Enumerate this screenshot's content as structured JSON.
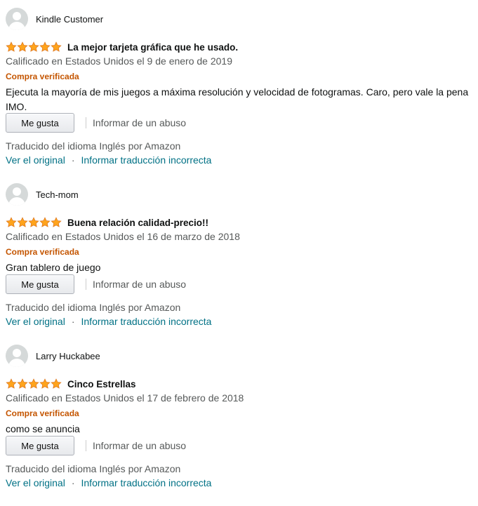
{
  "colors": {
    "star": "#ffa41c",
    "link": "#007185",
    "verified": "#c45500",
    "muted": "#565959"
  },
  "reviews": [
    {
      "profile_name": "Kindle Customer",
      "rating": 5,
      "title": "La mejor tarjeta gráfica que he usado.",
      "date": "Calificado en Estados Unidos el 9 de enero de 2019",
      "verified": "Compra verificada",
      "body": "Ejecuta la mayoría de mis juegos a máxima resolución y velocidad de fotogramas. Caro, pero vale la pena IMO.",
      "helpful_label": "Me gusta",
      "report_label": "Informar de un abuso",
      "translated": "Traducido del idioma Inglés por Amazon",
      "see_original": "Ver el original",
      "separator": "·",
      "report_translation": "Informar traducción incorrecta"
    },
    {
      "profile_name": "Tech-mom",
      "rating": 5,
      "title": "Buena relación calidad-precio!!",
      "date": "Calificado en Estados Unidos el 16 de marzo de 2018",
      "verified": "Compra verificada",
      "body": "Gran tablero de juego",
      "helpful_label": "Me gusta",
      "report_label": "Informar de un abuso",
      "translated": "Traducido del idioma Inglés por Amazon",
      "see_original": "Ver el original",
      "separator": "·",
      "report_translation": "Informar traducción incorrecta"
    },
    {
      "profile_name": "Larry Huckabee",
      "rating": 5,
      "title": "Cinco Estrellas",
      "date": "Calificado en Estados Unidos el 17 de febrero de 2018",
      "verified": "Compra verificada",
      "body": "como se anuncia",
      "helpful_label": "Me gusta",
      "report_label": "Informar de un abuso",
      "translated": "Traducido del idioma Inglés por Amazon",
      "see_original": "Ver el original",
      "separator": "·",
      "report_translation": "Informar traducción incorrecta"
    }
  ]
}
